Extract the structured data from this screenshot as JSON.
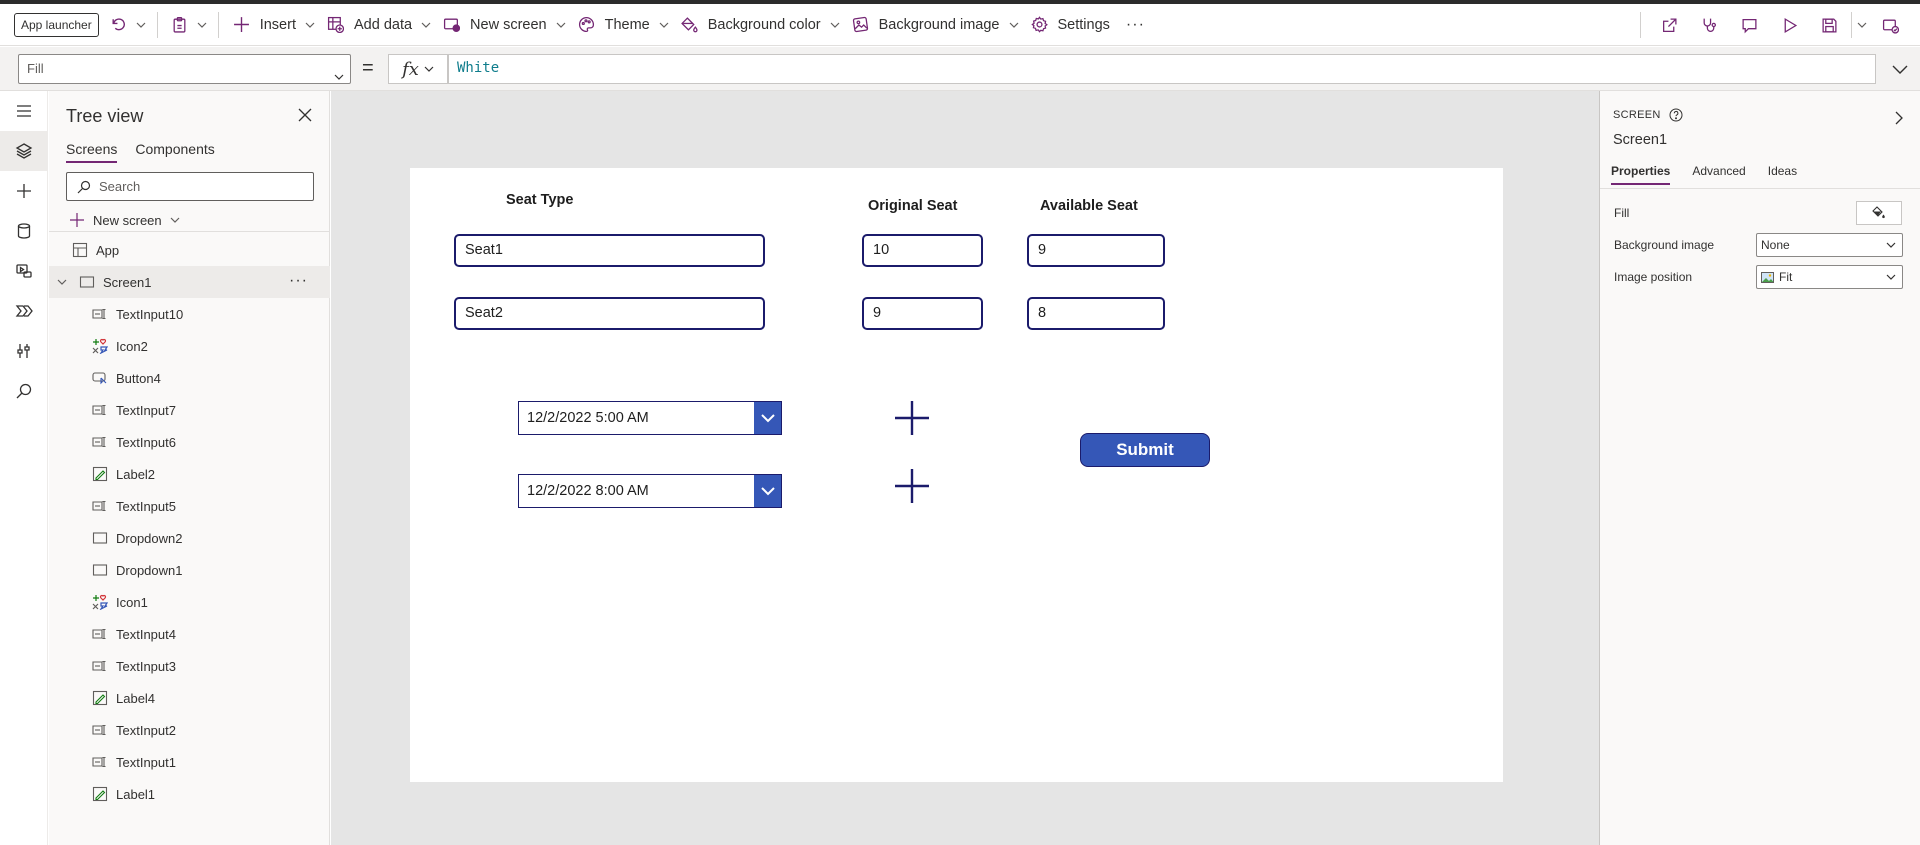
{
  "command_bar": {
    "app_launcher": "App launcher",
    "insert": "Insert",
    "add_data": "Add data",
    "new_screen": "New screen",
    "theme": "Theme",
    "background_color": "Background color",
    "background_image": "Background image",
    "settings": "Settings",
    "more": "···"
  },
  "formula_bar": {
    "property": "Fill",
    "equals": "=",
    "fx": "fx",
    "formula": "White"
  },
  "tree_view": {
    "title": "Tree view",
    "tabs": [
      "Screens",
      "Components"
    ],
    "search_placeholder": "Search",
    "new_screen": "New screen",
    "app": "App",
    "screen": "Screen1",
    "screen_more": "···",
    "items": [
      {
        "name": "TextInput10",
        "icon": "textinput-icon"
      },
      {
        "name": "Icon2",
        "icon": "icon-control-icon"
      },
      {
        "name": "Button4",
        "icon": "button-icon"
      },
      {
        "name": "TextInput7",
        "icon": "textinput-icon"
      },
      {
        "name": "TextInput6",
        "icon": "textinput-icon"
      },
      {
        "name": "Label2",
        "icon": "label-icon"
      },
      {
        "name": "TextInput5",
        "icon": "textinput-icon"
      },
      {
        "name": "Dropdown2",
        "icon": "dropdown-icon"
      },
      {
        "name": "Dropdown1",
        "icon": "dropdown-icon"
      },
      {
        "name": "Icon1",
        "icon": "icon-control-icon"
      },
      {
        "name": "TextInput4",
        "icon": "textinput-icon"
      },
      {
        "name": "TextInput3",
        "icon": "textinput-icon"
      },
      {
        "name": "Label4",
        "icon": "label-icon"
      },
      {
        "name": "TextInput2",
        "icon": "textinput-icon"
      },
      {
        "name": "TextInput1",
        "icon": "textinput-icon"
      },
      {
        "name": "Label1",
        "icon": "label-icon"
      }
    ]
  },
  "canvas": {
    "labels": {
      "seat_type": "Seat Type",
      "original_seat": "Original Seat",
      "available_seat": "Available Seat"
    },
    "rows": [
      {
        "seat_type": "Seat1",
        "original": "10",
        "available": "9"
      },
      {
        "seat_type": "Seat2",
        "original": "9",
        "available": "8"
      }
    ],
    "dates": [
      "12/2/2022 5:00 AM",
      "12/2/2022 8:00 AM"
    ],
    "submit": "Submit",
    "colors": {
      "accent": "#3557b7",
      "border": "#1b1b6b",
      "canvas_bg": "#ffffff",
      "workspace_bg": "#e5e5e5"
    }
  },
  "properties_panel": {
    "type": "SCREEN",
    "name": "Screen1",
    "tabs": [
      "Properties",
      "Advanced",
      "Ideas"
    ],
    "fill_label": "Fill",
    "background_image_label": "Background image",
    "background_image_value": "None",
    "image_position_label": "Image position",
    "image_position_value": "Fit"
  },
  "colors": {
    "brand": "#742774",
    "selection_bg": "#edebe9"
  }
}
